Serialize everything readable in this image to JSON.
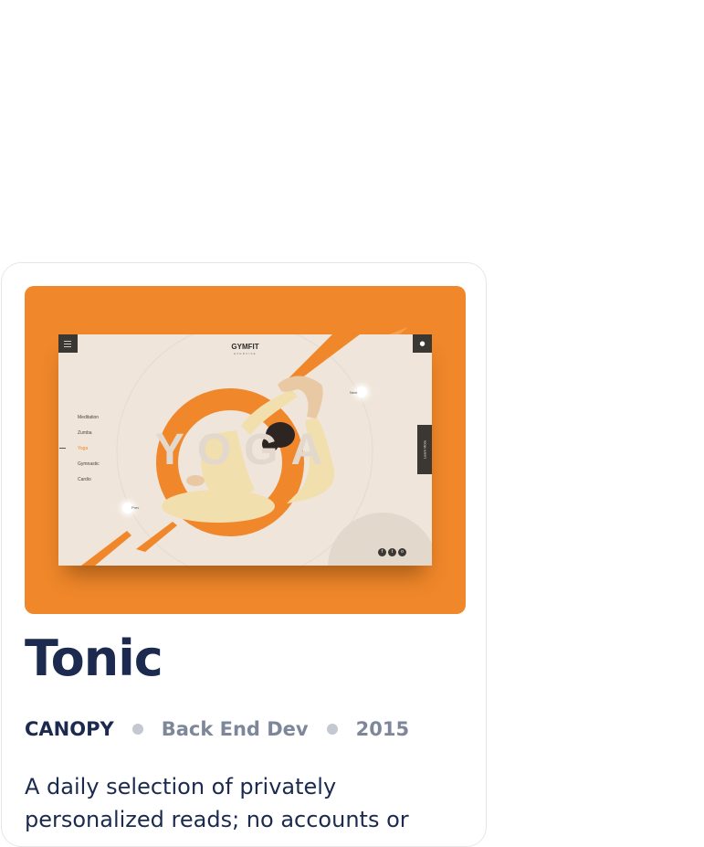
{
  "project": {
    "title": "Tonic",
    "client": "CANOPY",
    "role": "Back End Dev",
    "year": "2015",
    "description": "A daily selection of privately personalized reads; no accounts or"
  },
  "mockup": {
    "logo": "GYMFIT",
    "logo_sub": "EXERCISE",
    "background_word": "YOGA",
    "menu": [
      "Meditation",
      "Zumba",
      "Yoga",
      "Gymnastic",
      "Cardio"
    ],
    "active_menu_index": 2,
    "next_label": "Next",
    "prev_label": "Prev",
    "side_tab_label": "Learn More",
    "social_icons": [
      "facebook-icon",
      "twitter-icon",
      "instagram-icon"
    ],
    "social_glyphs": [
      "f",
      "t",
      "o"
    ]
  },
  "colors": {
    "accent": "#f0872a",
    "title": "#1b2a4e",
    "muted": "#7e8799",
    "separator": "#c3c8d1",
    "mockup_bg": "#efe5da",
    "mockup_dark": "#3b3833"
  }
}
